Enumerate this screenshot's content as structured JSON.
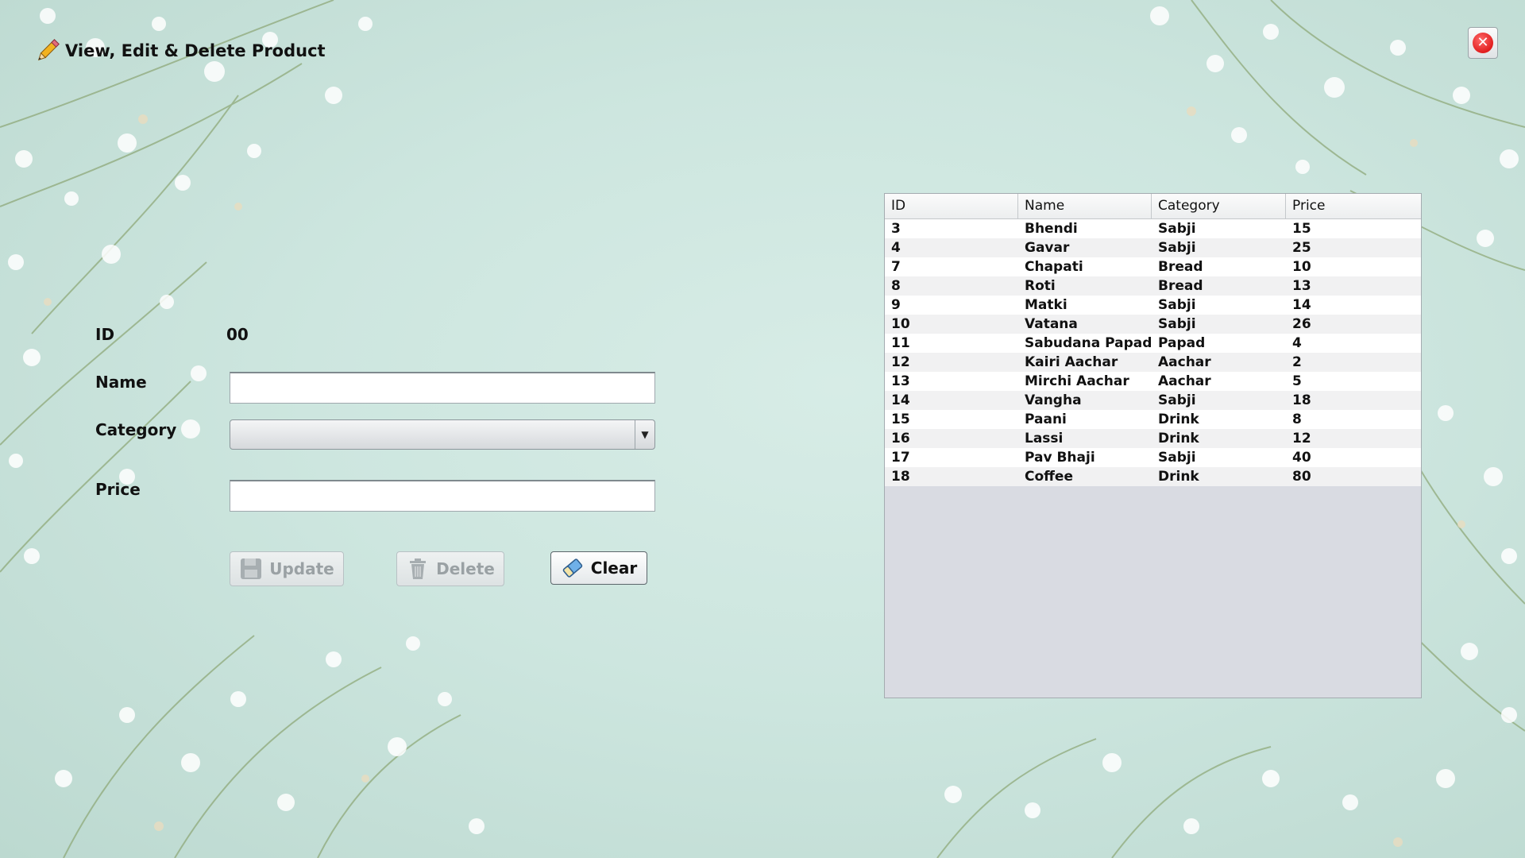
{
  "window": {
    "title": "View, Edit & Delete Product",
    "close_icon": "close-icon"
  },
  "form": {
    "id_label": "ID",
    "id_value": "00",
    "name_label": "Name",
    "name_value": "",
    "category_label": "Category",
    "category_value": "",
    "price_label": "Price",
    "price_value": ""
  },
  "buttons": {
    "update": {
      "label": "Update",
      "icon": "save-icon",
      "enabled": false
    },
    "delete": {
      "label": "Delete",
      "icon": "trash-icon",
      "enabled": false
    },
    "clear": {
      "label": "Clear",
      "icon": "eraser-icon",
      "enabled": true
    }
  },
  "table": {
    "columns": [
      "ID",
      "Name",
      "Category",
      "Price"
    ],
    "rows": [
      [
        "3",
        "Bhendi",
        "Sabji",
        "15"
      ],
      [
        "4",
        "Gavar",
        "Sabji",
        "25"
      ],
      [
        "7",
        "Chapati",
        "Bread",
        "10"
      ],
      [
        "8",
        "Roti",
        "Bread",
        "13"
      ],
      [
        "9",
        "Matki",
        "Sabji",
        "14"
      ],
      [
        "10",
        "Vatana",
        "Sabji",
        "26"
      ],
      [
        "11",
        "Sabudana Papad",
        "Papad",
        "4"
      ],
      [
        "12",
        "Kairi Aachar",
        "Aachar",
        "2"
      ],
      [
        "13",
        "Mirchi Aachar",
        "Aachar",
        "5"
      ],
      [
        "14",
        "Vangha",
        "Sabji",
        "18"
      ],
      [
        "15",
        "Paani",
        "Drink",
        "8"
      ],
      [
        "16",
        "Lassi",
        "Drink",
        "12"
      ],
      [
        "17",
        "Pav Bhaji",
        "Sabji",
        "40"
      ],
      [
        "18",
        "Coffee",
        "Drink",
        "80"
      ]
    ]
  },
  "colors": {
    "background": "#cde6df",
    "close_red": "#e11e1e",
    "table_empty": "#d9dbe2"
  }
}
